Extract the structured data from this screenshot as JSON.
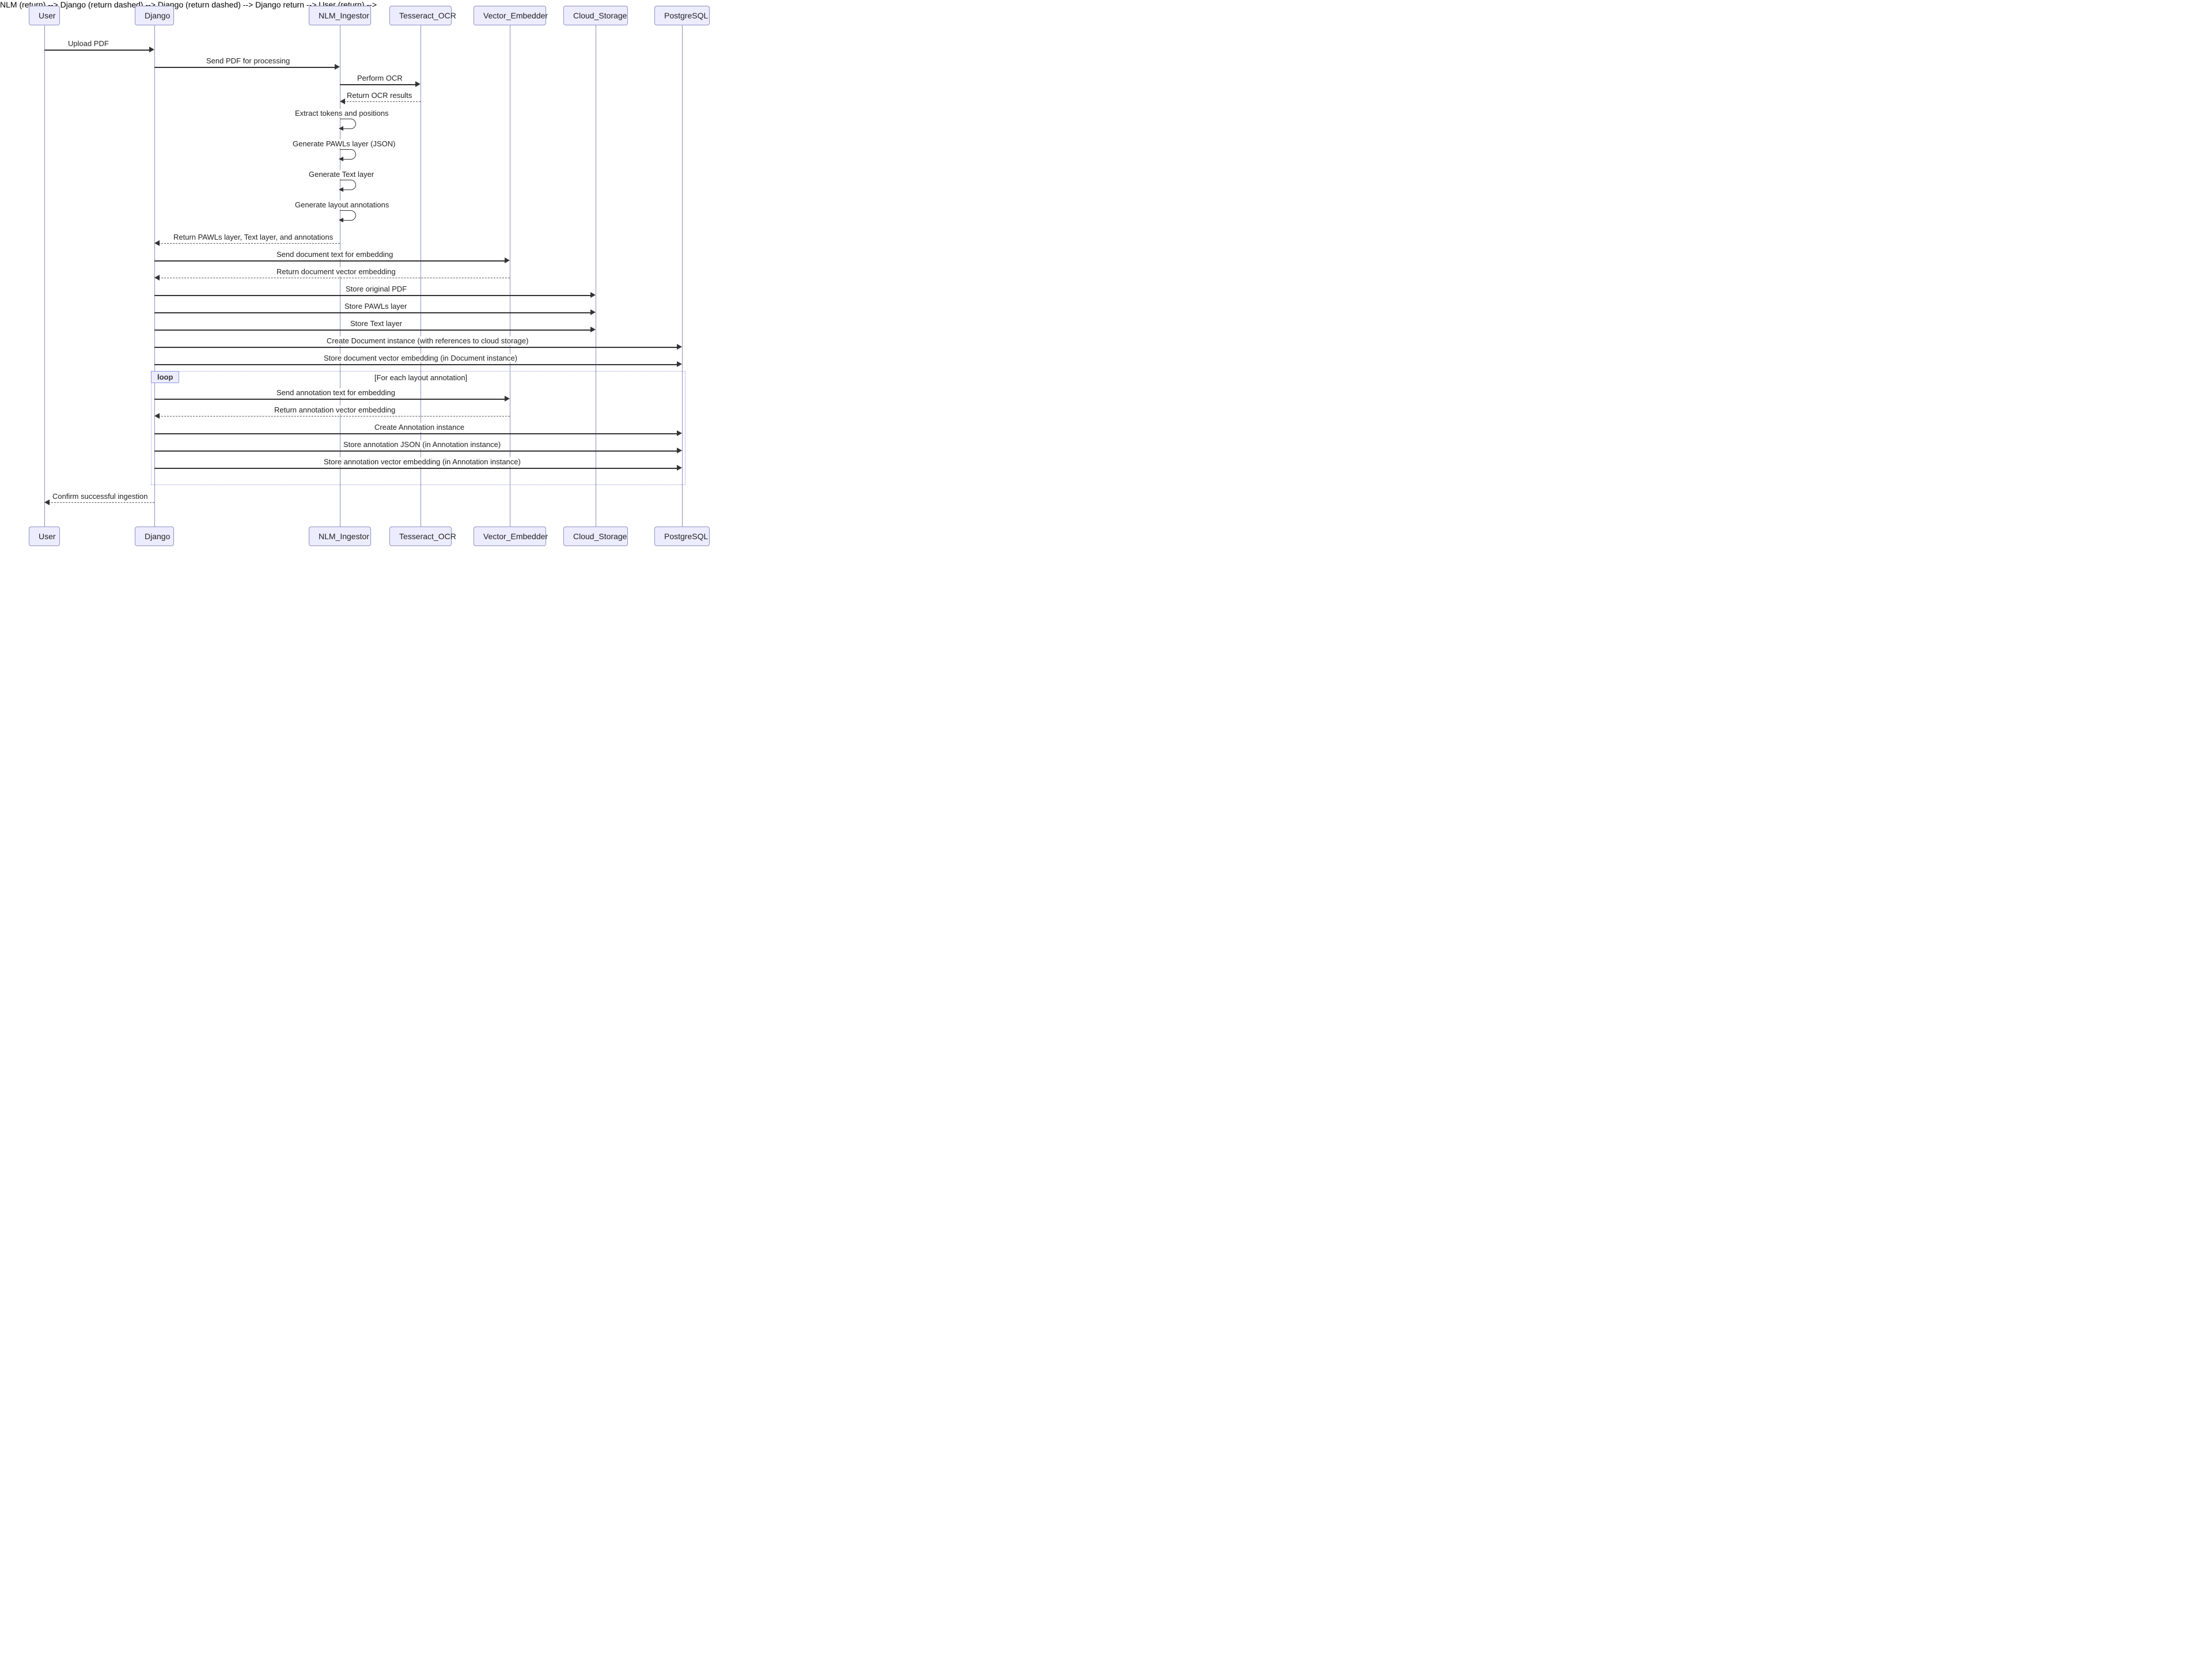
{
  "participants": {
    "user": "User",
    "django": "Django",
    "nlm": "NLM_Ingestor",
    "ocr": "Tesseract_OCR",
    "embedder": "Vector_Embedder",
    "storage": "Cloud_Storage",
    "postgres": "PostgreSQL"
  },
  "messages": {
    "m1": "Upload PDF",
    "m2": "Send PDF for processing",
    "m3": "Perform OCR",
    "m4": "Return OCR results",
    "m5": "Extract tokens and positions",
    "m6": "Generate PAWLs layer (JSON)",
    "m7": "Generate Text layer",
    "m8": "Generate layout annotations",
    "m9": "Return PAWLs layer, Text layer, and annotations",
    "m10": "Send document text for embedding",
    "m11": "Return document vector embedding",
    "m12": "Store original PDF",
    "m13": "Store PAWLs layer",
    "m14": "Store Text layer",
    "m15": "Create Document instance (with references to cloud storage)",
    "m16": "Store document vector embedding (in Document instance)",
    "m17": "Send annotation text for embedding",
    "m18": "Return annotation vector embedding",
    "m19": "Create Annotation instance",
    "m20": "Store annotation JSON (in Annotation instance)",
    "m21": "Store annotation vector embedding (in Annotation instance)",
    "m22": "Confirm successful ingestion"
  },
  "loop": {
    "tag": "loop",
    "condition": "[For each layout annotation]"
  }
}
